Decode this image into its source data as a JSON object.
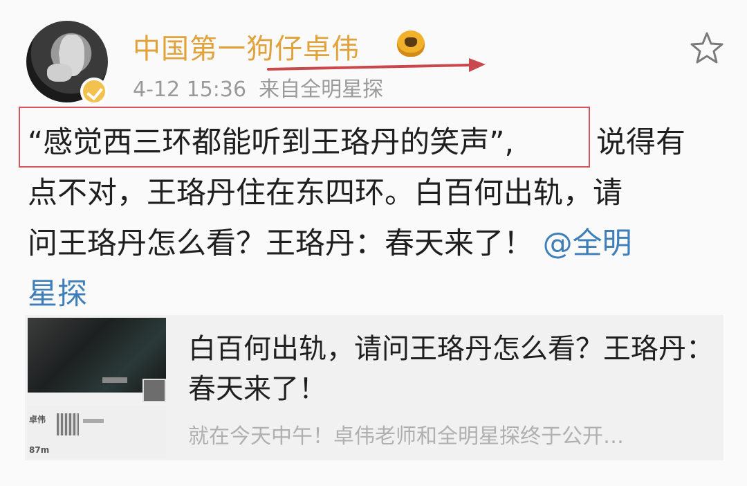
{
  "post": {
    "username": "中国第一狗仔卓伟",
    "timestamp": "4-12 15:36",
    "source": "来自全明星探",
    "icons": {
      "avatar": "avatar-image",
      "verified": "verified-badge-icon",
      "vip": "vip-crown-icon",
      "favorite": "star-icon"
    },
    "body": {
      "quote": "“感觉西三环都能听到王珞丹的笑声”,",
      "line1_rest": "说得有",
      "line2": "点不对，王珞丹住在东四环。白百何出轨，请",
      "line3": "问王珞丹怎么看？王珞丹：春天来了！",
      "mention_line3": "@全明",
      "mention_line4": "星探"
    },
    "annotation_colors": {
      "highlight_box": "#d9535a",
      "arrow": "#c9484e"
    }
  },
  "card": {
    "title": "白百何出轨，请问王珞丹怎么看？王珞丹：春天来了！",
    "subtitle": "就在今天中午！卓伟老师和全明星探终于公开…",
    "thumb_labels": {
      "top": "卓伟",
      "bottom": "87m"
    }
  }
}
